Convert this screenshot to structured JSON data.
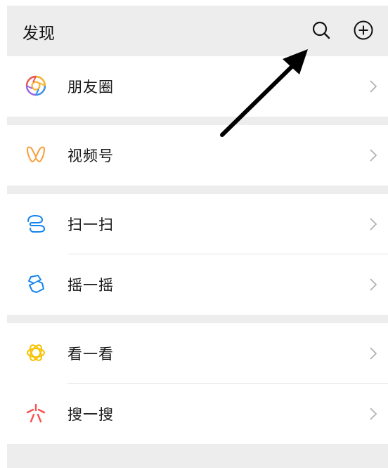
{
  "header": {
    "title": "发现",
    "search_icon": "search-icon",
    "add_icon": "plus-circle-icon"
  },
  "groups": [
    {
      "items": [
        {
          "label": "朋友圈",
          "icon": "moments-icon"
        }
      ]
    },
    {
      "items": [
        {
          "label": "视频号",
          "icon": "channels-icon"
        }
      ]
    },
    {
      "items": [
        {
          "label": "扫一扫",
          "icon": "scan-icon"
        },
        {
          "label": "摇一摇",
          "icon": "shake-icon"
        }
      ]
    },
    {
      "items": [
        {
          "label": "看一看",
          "icon": "top-stories-icon"
        },
        {
          "label": "搜一搜",
          "icon": "search-spark-icon"
        }
      ]
    }
  ],
  "colors": {
    "background": "#ededed",
    "row_background": "#ffffff",
    "text": "#191919",
    "chevron": "#b2b2b2",
    "channels": "#fa9d3b",
    "scan": "#1485ee",
    "shake": "#1485ee",
    "top_stories": "#f7c100",
    "search_spark": "#fa5151",
    "annotation_arrow": "#000000"
  }
}
